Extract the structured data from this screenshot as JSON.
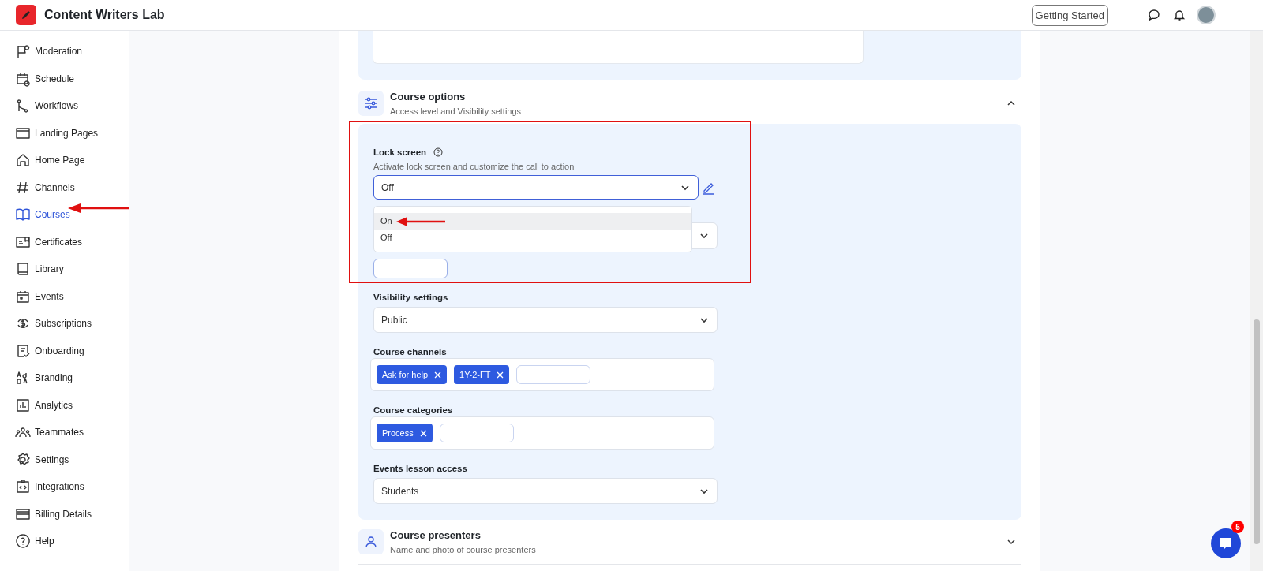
{
  "header": {
    "title": "Content Writers Lab",
    "getting_started": "Getting Started"
  },
  "sidebar": {
    "items": [
      {
        "label": "Moderation",
        "selected": false
      },
      {
        "label": "Schedule",
        "selected": false
      },
      {
        "label": "Workflows",
        "selected": false
      },
      {
        "label": "Landing Pages",
        "selected": false
      },
      {
        "label": "Home Page",
        "selected": false
      },
      {
        "label": "Channels",
        "selected": false
      },
      {
        "label": "Courses",
        "selected": true
      },
      {
        "label": "Certificates",
        "selected": false
      },
      {
        "label": "Library",
        "selected": false
      },
      {
        "label": "Events",
        "selected": false
      },
      {
        "label": "Subscriptions",
        "selected": false
      },
      {
        "label": "Onboarding",
        "selected": false
      },
      {
        "label": "Branding",
        "selected": false
      },
      {
        "label": "Analytics",
        "selected": false
      },
      {
        "label": "Teammates",
        "selected": false
      },
      {
        "label": "Settings",
        "selected": false
      },
      {
        "label": "Integrations",
        "selected": false
      },
      {
        "label": "Billing Details",
        "selected": false
      },
      {
        "label": "Help",
        "selected": false
      }
    ]
  },
  "course_options": {
    "title": "Course options",
    "subtitle": "Access level and Visibility settings",
    "expanded": true,
    "lock_screen": {
      "label": "Lock screen",
      "description": "Activate lock screen and customize the call to action",
      "value": "Off",
      "expanded": true,
      "options": [
        {
          "label": "On",
          "highlighted": true
        },
        {
          "label": "Off",
          "highlighted": false
        }
      ]
    },
    "visibility": {
      "label": "Visibility settings",
      "value": "Public"
    },
    "channels": {
      "label": "Course channels",
      "tags": [
        "Ask for help",
        "1Y-2-FT"
      ]
    },
    "categories": {
      "label": "Course categories",
      "tags": [
        "Process"
      ]
    },
    "events_access": {
      "label": "Events lesson access",
      "value": "Students"
    }
  },
  "course_presenters": {
    "title": "Course presenters",
    "subtitle": "Name and photo of course presenters",
    "expanded": false
  },
  "chat": {
    "badge": "5"
  }
}
